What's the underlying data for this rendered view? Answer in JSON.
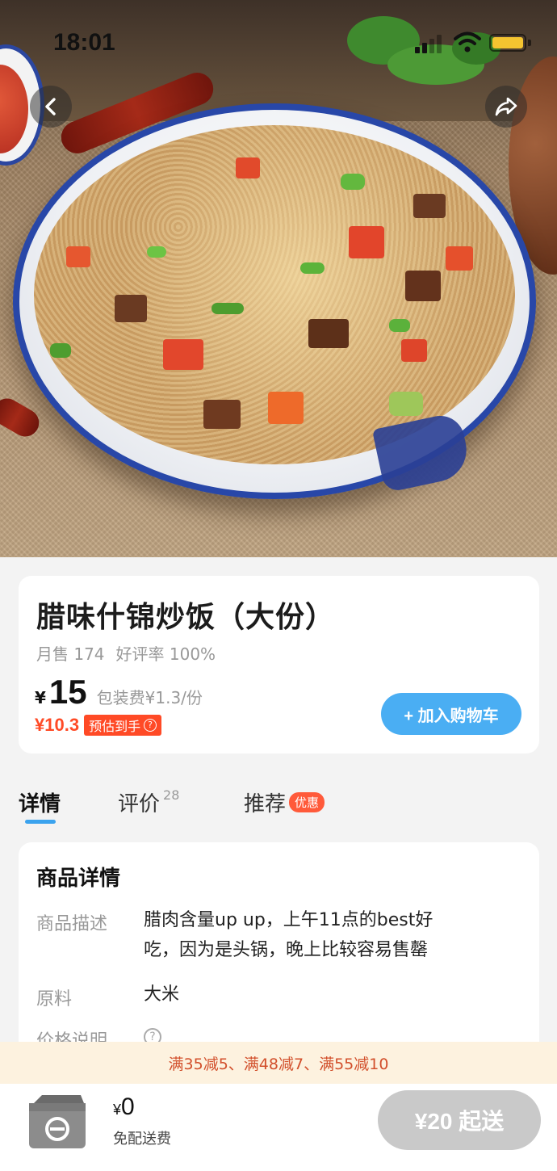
{
  "status_bar": {
    "time": "18:01"
  },
  "hero": {
    "back_icon": "chevron-left-icon",
    "share_icon": "share-arrow-icon"
  },
  "product": {
    "name": "腊味什锦炒饭（大份）",
    "monthly_sales": "月售 174",
    "rating": "好评率 100%",
    "currency": "¥",
    "price": "15",
    "packaging_fee": "包装费¥1.3/份",
    "estimated_price": "¥10.3",
    "estimated_label": "预估到手",
    "add_to_cart": "+ 加入购物车"
  },
  "tabs": [
    {
      "label": "详情",
      "active": true
    },
    {
      "label": "评价",
      "count": "28"
    },
    {
      "label": "推荐",
      "badge": "优惠"
    }
  ],
  "details": {
    "title": "商品详情",
    "rows": [
      {
        "label": "商品描述",
        "value_line1": "腊肉含量up up，上午11点的best好",
        "value_line2": "吃，因为是头锅，晚上比较容易售罄"
      },
      {
        "label": "原料",
        "value": "大米"
      },
      {
        "label": "价格说明"
      }
    ]
  },
  "promo": {
    "text": "满35减5、满48减7、满55减10"
  },
  "bottom_bar": {
    "currency": "¥",
    "cart_total": "0",
    "delivery_fee": "免配送费",
    "min_order": "¥20 起送"
  },
  "colors": {
    "accent_blue": "#4aaef3",
    "price_red": "#ff4a26",
    "promo_bg": "#fdf2df",
    "disabled_gray": "#c9c9c9"
  }
}
